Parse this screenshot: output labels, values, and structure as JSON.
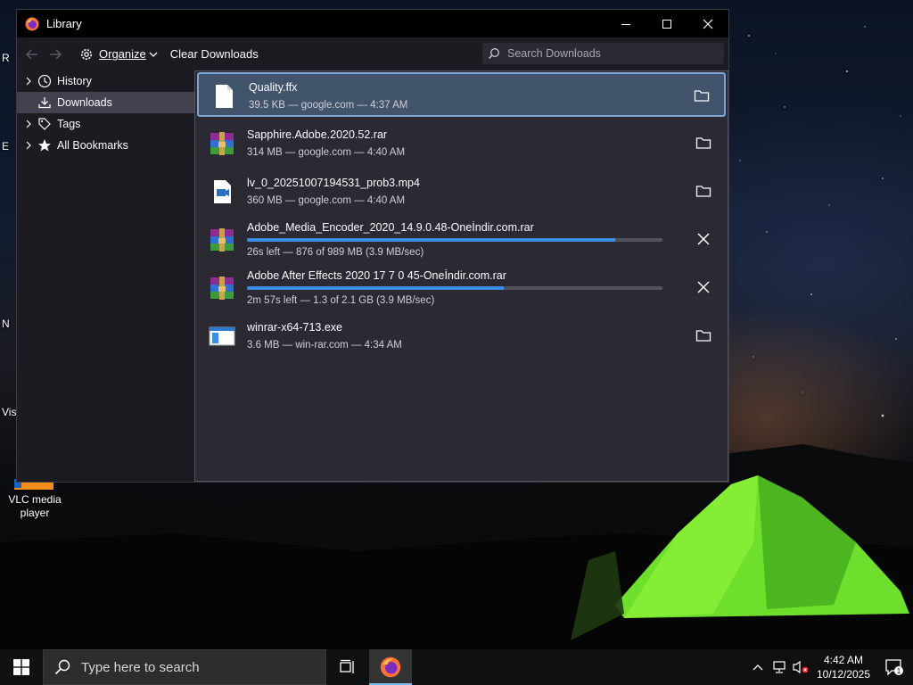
{
  "desktop": {
    "icons": [
      {
        "label": "VLC media player"
      }
    ],
    "edge_letters": [
      "R",
      "E",
      "N",
      "Vis"
    ]
  },
  "window": {
    "title": "Library",
    "buttons": {
      "minimize": "minimize",
      "maximize": "maximize",
      "close": "close"
    }
  },
  "toolbar": {
    "back_icon": "arrow-left-icon",
    "forward_icon": "arrow-right-icon",
    "organize_label": "Organize",
    "clear_label": "Clear Downloads",
    "search_placeholder": "Search Downloads"
  },
  "sidebar": {
    "items": [
      {
        "label": "History",
        "icon": "clock-icon",
        "expandable": true,
        "selected": false
      },
      {
        "label": "Downloads",
        "icon": "download-icon",
        "expandable": false,
        "selected": true
      },
      {
        "label": "Tags",
        "icon": "tag-icon",
        "expandable": true,
        "selected": false
      },
      {
        "label": "All Bookmarks",
        "icon": "star-icon",
        "expandable": true,
        "selected": false
      }
    ]
  },
  "downloads": [
    {
      "name": "Quality.ffx",
      "status": "39.5 KB — google.com — 4:37 AM",
      "icon": "file-icon",
      "action": "open-folder",
      "selected": true
    },
    {
      "name": "Sapphire.Adobe.2020.52.rar",
      "status": "314 MB — google.com — 4:40 AM",
      "icon": "winrar-archive-icon",
      "action": "open-folder",
      "selected": false
    },
    {
      "name": "lv_0_20251007194531_prob3.mp4",
      "status": "360 MB — google.com — 4:40 AM",
      "icon": "video-file-icon",
      "action": "open-folder",
      "selected": false
    },
    {
      "name": "Adobe_Media_Encoder_2020_14.9.0.48-Oneİndir.com.rar",
      "status": "26s left — 876 of 989 MB (3.9 MB/sec)",
      "icon": "winrar-archive-icon",
      "action": "cancel",
      "progress": 0.886,
      "selected": false
    },
    {
      "name": "Adobe After Effects 2020 17 7 0 45-Oneİndir.com.rar",
      "status": "2m 57s left — 1.3 of 2.1 GB (3.9 MB/sec)",
      "icon": "winrar-archive-icon",
      "action": "cancel",
      "progress": 0.619,
      "selected": false
    },
    {
      "name": "winrar-x64-713.exe",
      "status": "3.6 MB — win-rar.com — 4:34 AM",
      "icon": "installer-icon",
      "action": "open-folder",
      "selected": false
    }
  ],
  "taskbar": {
    "search_placeholder": "Type here to search",
    "time": "4:42 AM",
    "date": "10/12/2025",
    "notification_count": "1"
  },
  "colors": {
    "accent": "#3d8ee6",
    "selected_row": "#42546c",
    "content_bg": "#2b2a33"
  }
}
